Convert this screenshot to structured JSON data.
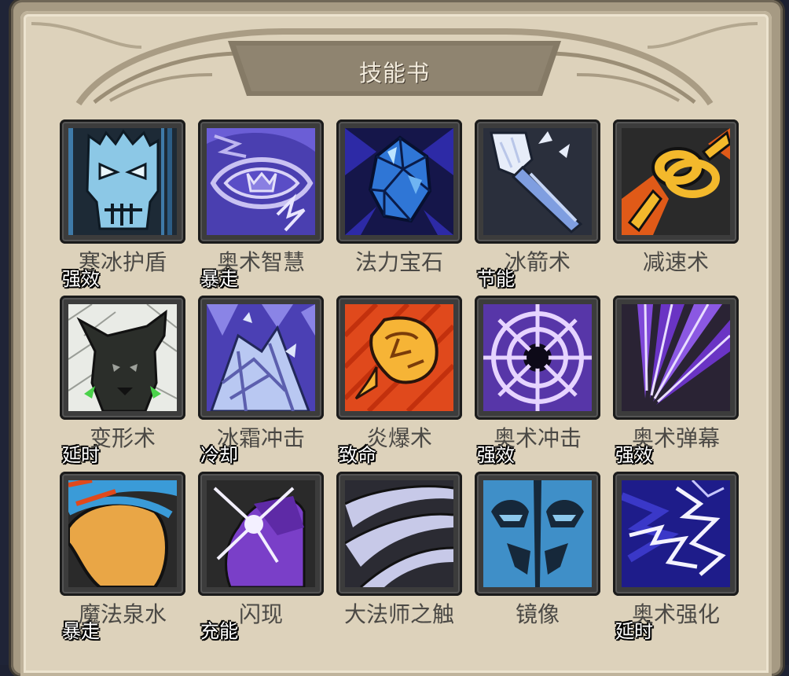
{
  "title": "技能书",
  "skills": [
    {
      "name": "寒冰护盾",
      "tag": "强效",
      "icon": "ice-skull-icon"
    },
    {
      "name": "奥术智慧",
      "tag": "暴走",
      "icon": "arcane-eye-icon"
    },
    {
      "name": "法力宝石",
      "tag": "",
      "icon": "blue-gem-icon"
    },
    {
      "name": "冰箭术",
      "tag": "节能",
      "icon": "ice-arrow-icon"
    },
    {
      "name": "减速术",
      "tag": "",
      "icon": "gold-chain-icon"
    },
    {
      "name": "变形术",
      "tag": "延时",
      "icon": "sheep-head-icon"
    },
    {
      "name": "冰霜冲击",
      "tag": "冷却",
      "icon": "frost-shards-icon"
    },
    {
      "name": "炎爆术",
      "tag": "致命",
      "icon": "fireball-icon"
    },
    {
      "name": "奥术冲击",
      "tag": "强效",
      "icon": "arcane-web-icon"
    },
    {
      "name": "奥术弹幕",
      "tag": "强效",
      "icon": "arcane-rays-icon"
    },
    {
      "name": "魔法泉水",
      "tag": "暴走",
      "icon": "mana-fountain-icon"
    },
    {
      "name": "闪现",
      "tag": "充能",
      "icon": "blink-star-icon"
    },
    {
      "name": "大法师之触",
      "tag": "",
      "icon": "claw-strike-icon"
    },
    {
      "name": "镜像",
      "tag": "",
      "icon": "mirror-faces-icon"
    },
    {
      "name": "奥术强化",
      "tag": "延时",
      "icon": "lightning-burst-icon"
    }
  ]
}
